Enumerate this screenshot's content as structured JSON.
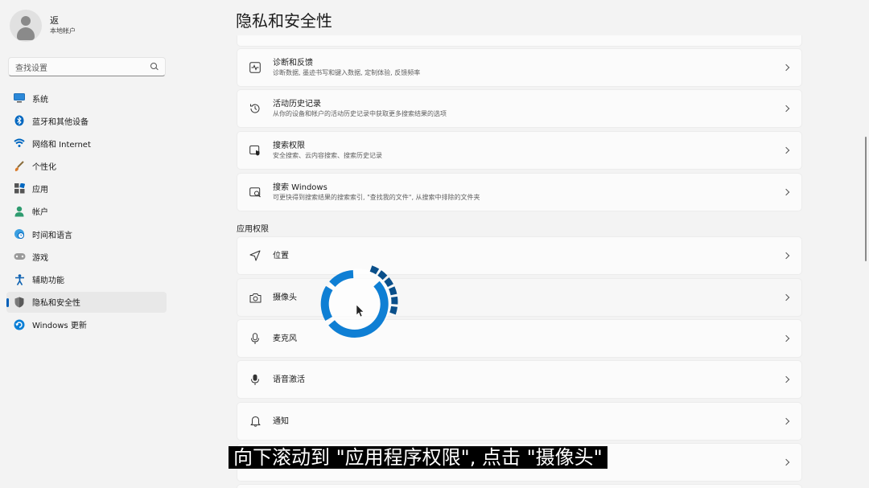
{
  "user": {
    "name": "返",
    "type": "本地帐户"
  },
  "search": {
    "placeholder": "查找设置"
  },
  "nav": [
    {
      "id": "system",
      "label": "系统",
      "icon": "monitor-icon"
    },
    {
      "id": "bluetooth",
      "label": "蓝牙和其他设备",
      "icon": "bluetooth-icon"
    },
    {
      "id": "network",
      "label": "网络和 Internet",
      "icon": "wifi-icon"
    },
    {
      "id": "personalization",
      "label": "个性化",
      "icon": "brush-icon"
    },
    {
      "id": "apps",
      "label": "应用",
      "icon": "apps-icon"
    },
    {
      "id": "accounts",
      "label": "帐户",
      "icon": "person-icon"
    },
    {
      "id": "time-language",
      "label": "时间和语言",
      "icon": "globe-clock-icon"
    },
    {
      "id": "gaming",
      "label": "游戏",
      "icon": "gamepad-icon"
    },
    {
      "id": "accessibility",
      "label": "辅助功能",
      "icon": "accessibility-icon"
    },
    {
      "id": "privacy",
      "label": "隐私和安全性",
      "icon": "shield-icon",
      "active": true
    },
    {
      "id": "update",
      "label": "Windows 更新",
      "icon": "update-icon"
    }
  ],
  "main": {
    "title": "隐私和安全性",
    "cards_top": [
      {
        "title": "诊断和反馈",
        "subtitle": "诊断数据, 墨迹书写和键入数据, 定制体验, 反馈频率",
        "icon": "diagnostics-icon"
      },
      {
        "title": "活动历史记录",
        "subtitle": "从你的设备和帐户的活动历史记录中获取更多搜索结果的选项",
        "icon": "history-icon"
      },
      {
        "title": "搜索权限",
        "subtitle": "安全搜索、云内容搜索、搜索历史记录",
        "icon": "search-permission-icon"
      },
      {
        "title": "搜索 Windows",
        "subtitle": "可更快得到搜索结果的搜索索引, \"查找我的文件\", 从搜索中排除的文件夹",
        "icon": "search-windows-icon"
      }
    ],
    "section_label": "应用权限",
    "cards_apps": [
      {
        "title": "位置",
        "icon": "location-icon"
      },
      {
        "title": "摄像头",
        "icon": "camera-icon"
      },
      {
        "title": "麦克风",
        "icon": "microphone-icon"
      },
      {
        "title": "语音激活",
        "icon": "voice-icon"
      },
      {
        "title": "通知",
        "icon": "bell-icon"
      }
    ]
  },
  "caption": "向下滚动到 \"应用程序权限\", 点击 \"摄像头\"",
  "colors": {
    "accent": "#005fb8",
    "spinner_light": "#0f7fd4",
    "spinner_dark": "#0a4f8a"
  }
}
